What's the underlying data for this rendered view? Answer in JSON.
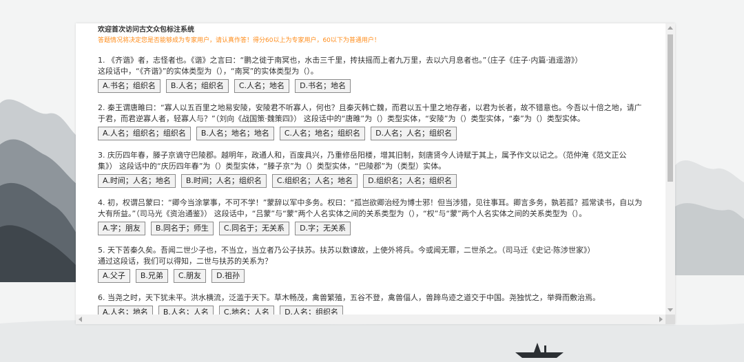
{
  "header": {
    "welcome": "欢迎首次访问古文众包标注系统",
    "note": "答题情况将决定您是否能够成为专家用户，请认真作答！得分60以上为专家用户，60以下为普通用户！"
  },
  "questions": [
    {
      "text": "1. 《齐谐》者，志怪者也。《谐》之言曰：“鹏之徙于南冥也，水击三千里，抟扶摇而上者九万里，去以六月息者也。”（庄子《庄子·内篇·逍遥游》）\n这段话中，“《齐谐》”的实体类型为（），“南冥”的实体类型为（）。",
      "options": [
        "A.书名；组织名",
        "B.人名；组织名",
        "C.人名；地名",
        "D.书名；地名"
      ]
    },
    {
      "text": "2. 秦王谓唐雎曰：“寡人以五百里之地易安陵，安陵君不听寡人，何也？且秦灭韩亡魏，而君以五十里之地存者，以君为长者，故不错意也。今吾以十倍之地，请广于君，而君逆寡人者，轻寡人与？”（刘向《战国策·魏策四》） 这段话中的“唐雎”为（）类型实体，“安陵”为（）类型实体，“秦”为（）类型实体。",
      "options": [
        "A.人名；组织名；组织名",
        "B.人名；地名；地名",
        "C.人名；地名；组织名",
        "D.人名；人名；组织名"
      ]
    },
    {
      "text": "3. 庆历四年春，滕子京谪守巴陵郡。越明年，政通人和，百废具兴，乃重修岳阳楼，增其旧制，刻唐贤今人诗赋于其上，属予作文以记之。（范仲淹《范文正公集》） 这段话中的“庆历四年春”为（）类型实体，“滕子京”为（）类型实体，“巴陵郡”为（类型）实体。",
      "options": [
        "A.时间；人名；地名",
        "B.时间；人名；组织名",
        "C.组织名；人名；地名",
        "D.组织名；人名；组织名"
      ]
    },
    {
      "text": "4. 初，权谓吕蒙曰：“卿今当涂掌事，不可不学！”蒙辞以军中多务。权曰：“孤岂欲卿治经为博士邪！但当涉猎，见往事耳。卿言多务，孰若孤？孤常读书，自以为大有所益。”（司马光《资治通鉴》） 这段话中，“吕蒙”与“蒙”两个人名实体之间的关系类型为（），“权”与“蒙”两个人名实体之间的关系类型为（）。",
      "options": [
        "A.字；朋友",
        "B.同名于；师生",
        "C.同名于；无关系",
        "D.字；无关系"
      ]
    },
    {
      "text": "5. 天下苦秦久矣。吾闻二世少子也，不当立，当立者乃公子扶苏。扶苏以数谏故，上使外将兵。今或闻无罪，二世杀之。（司马迁《史记·陈涉世家》）\n通过这段话，我们可以得知，二世与扶苏的关系为？",
      "options": [
        "A.父子",
        "B.兄弟",
        "C.朋友",
        "D.祖孙"
      ]
    },
    {
      "text": "6. 当尧之时，天下犹未平。洪水横流，泛滥于天下。草木畅茂，禽兽繁殖，五谷不登，禽兽偪人，兽蹄鸟迹之道交于中国。尧独忧之，举舜而敷治焉。",
      "options": [
        "A.人名；地名",
        "B.人名；人名",
        "C.地名；人名",
        "D.人名；组织名"
      ]
    }
  ]
}
